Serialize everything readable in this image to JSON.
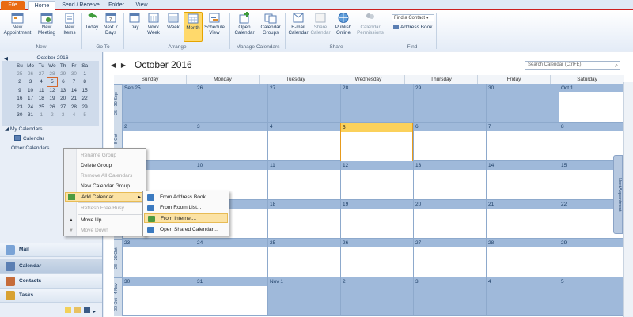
{
  "tabs": [
    "File",
    "Home",
    "Send / Receive",
    "Folder",
    "View"
  ],
  "ribbon": {
    "new": {
      "appointment": "New Appointment",
      "meeting": "New Meeting",
      "items": "New Items",
      "group": "New"
    },
    "goto": {
      "today": "Today",
      "next7": "Next 7 Days",
      "group": "Go To"
    },
    "arrange": {
      "day": "Day",
      "work_week": "Work Week",
      "week": "Week",
      "month": "Month",
      "schedule": "Schedule View",
      "group": "Arrange"
    },
    "manage": {
      "open": "Open Calendar",
      "groups": "Calendar Groups",
      "group": "Manage Calendars"
    },
    "share": {
      "email": "E-mail Calendar",
      "share": "Share Calendar",
      "publish": "Publish Online",
      "perm": "Calendar Permissions",
      "group": "Share"
    },
    "find": {
      "contact": "Find a Contact",
      "address_book": "Address Book",
      "group": "Find"
    }
  },
  "mini_calendar": {
    "title": "October 2016",
    "headers": [
      "Su",
      "Mo",
      "Tu",
      "We",
      "Th",
      "Fr",
      "Sa"
    ],
    "weeks": [
      [
        "25",
        "26",
        "27",
        "28",
        "29",
        "30",
        "1"
      ],
      [
        "2",
        "3",
        "4",
        "5",
        "6",
        "7",
        "8"
      ],
      [
        "9",
        "10",
        "11",
        "12",
        "13",
        "14",
        "15"
      ],
      [
        "16",
        "17",
        "18",
        "19",
        "20",
        "21",
        "22"
      ],
      [
        "23",
        "24",
        "25",
        "26",
        "27",
        "28",
        "29"
      ],
      [
        "30",
        "31",
        "1",
        "2",
        "3",
        "4",
        "5"
      ]
    ]
  },
  "nav": {
    "my_calendars": "My Calendars",
    "calendar": "Calendar",
    "other_calendars": "Other Calendars",
    "buttons": [
      "Mail",
      "Calendar",
      "Contacts",
      "Tasks"
    ]
  },
  "context_menu": {
    "items": [
      "Rename Group",
      "Delete Group",
      "Remove All Calendars",
      "New Calendar Group",
      "Add Calendar",
      "Refresh Free/Busy",
      "Move Up",
      "Move Down"
    ],
    "submenu": [
      "From Address Book...",
      "From Room List...",
      "From Internet...",
      "Open Shared Calendar..."
    ]
  },
  "calendar": {
    "title": "October 2016",
    "search_placeholder": "Search Calendar (Ctrl+E)",
    "weekdays": [
      "Sunday",
      "Monday",
      "Tuesday",
      "Wednesday",
      "Thursday",
      "Friday",
      "Saturday"
    ],
    "week_labels": [
      "25 - 30 Sep",
      "2 - 8 Oct",
      "9 - 15 Oct",
      "16 - 22 Oct",
      "23 - 29 Oct",
      "30 Oct - 4 Nov"
    ],
    "weeks": [
      [
        "Sep 25",
        "26",
        "27",
        "28",
        "29",
        "30",
        "Oct 1"
      ],
      [
        "2",
        "3",
        "4",
        "5",
        "6",
        "7",
        "8"
      ],
      [
        "9",
        "10",
        "11",
        "12",
        "13",
        "14",
        "15"
      ],
      [
        "16",
        "17",
        "18",
        "19",
        "20",
        "21",
        "22"
      ],
      [
        "23",
        "24",
        "25",
        "26",
        "27",
        "28",
        "29"
      ],
      [
        "30",
        "31",
        "Nov 1",
        "2",
        "3",
        "4",
        "5"
      ]
    ],
    "peek": "Next Appointment"
  }
}
